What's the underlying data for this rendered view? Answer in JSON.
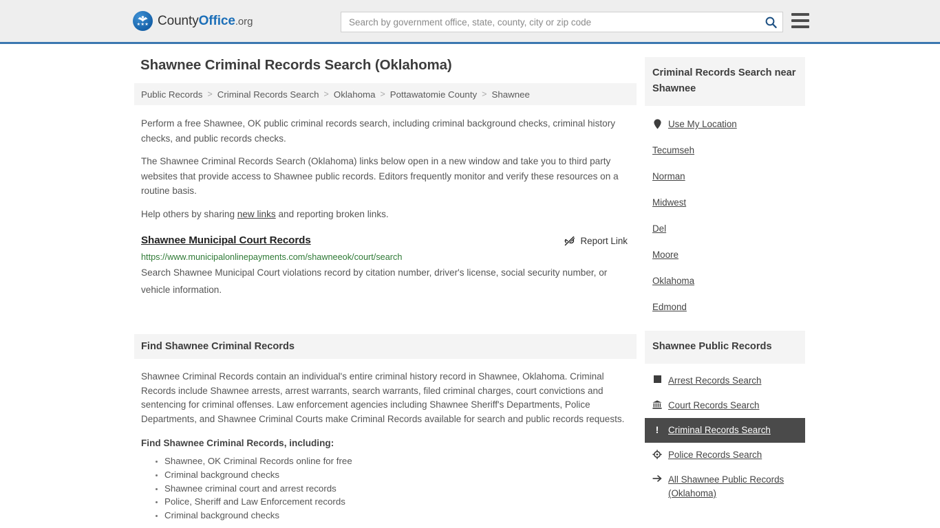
{
  "header": {
    "brand": {
      "county": "County",
      "office": "Office",
      "org": ".org",
      "icon": "eagle-seal-icon",
      "stars": "★★★"
    },
    "search": {
      "placeholder": "Search by government office, state, county, city or zip code",
      "value": "",
      "button_icon": "search-icon"
    },
    "menu_icon": "hamburger-menu-icon",
    "accent_color": "#3b77b0"
  },
  "page": {
    "title": "Shawnee Criminal Records Search (Oklahoma)"
  },
  "breadcrumb": {
    "separator": ">",
    "items": [
      "Public Records",
      "Criminal Records Search",
      "Oklahoma",
      "Pottawatomie County",
      "Shawnee"
    ]
  },
  "intro": {
    "p1": "Perform a free Shawnee, OK public criminal records search, including criminal background checks, criminal history checks, and public records checks.",
    "p2": "The Shawnee Criminal Records Search (Oklahoma) links below open in a new window and take you to third party websites that provide access to Shawnee public records. Editors frequently monitor and verify these resources on a routine basis.",
    "p3_before": "Help others by sharing ",
    "p3_link": "new links",
    "p3_after": " and reporting broken links."
  },
  "result": {
    "title": "Shawnee Municipal Court Records",
    "report_label": "Report Link",
    "report_icon": "broken-link-icon",
    "url": "https://www.municipalonlinepayments.com/shawneeok/court/search",
    "url_color": "#2f7a36",
    "description": "Search Shawnee Municipal Court violations record by citation number, driver's license, social security number, or vehicle information."
  },
  "find_section": {
    "heading": "Find Shawnee Criminal Records",
    "paragraph": "Shawnee Criminal Records contain an individual's entire criminal history record in Shawnee, Oklahoma. Criminal Records include Shawnee arrests, arrest warrants, search warrants, filed criminal charges, court convictions and sentencing for criminal offenses. Law enforcement agencies including Shawnee Sheriff's Departments, Police Departments, and Shawnee Criminal Courts make Criminal Records available for search and public records requests.",
    "subheading": "Find Shawnee Criminal Records, including:",
    "bullets": [
      "Shawnee, OK Criminal Records online for free",
      "Criminal background checks",
      "Shawnee criminal court and arrest records",
      "Police, Sheriff and Law Enforcement records",
      "Criminal background checks"
    ]
  },
  "sidebar": {
    "near": {
      "heading": "Criminal Records Search near Shawnee",
      "items": [
        {
          "label": "Use My Location",
          "icon": "map-pin-icon",
          "has_icon": true
        },
        {
          "label": "Tecumseh",
          "icon": "",
          "has_icon": false
        },
        {
          "label": "Norman",
          "icon": "",
          "has_icon": false
        },
        {
          "label": "Midwest",
          "icon": "",
          "has_icon": false
        },
        {
          "label": "Del",
          "icon": "",
          "has_icon": false
        },
        {
          "label": "Moore",
          "icon": "",
          "has_icon": false
        },
        {
          "label": "Oklahoma",
          "icon": "",
          "has_icon": false
        },
        {
          "label": "Edmond",
          "icon": "",
          "has_icon": false
        }
      ]
    },
    "public_records": {
      "heading": "Shawnee Public Records",
      "active_bg": "#4a4a4a",
      "items": [
        {
          "label": "Arrest Records Search",
          "icon": "filled-square-icon",
          "active": false
        },
        {
          "label": "Court Records Search",
          "icon": "courthouse-icon",
          "active": false
        },
        {
          "label": "Criminal Records Search",
          "icon": "exclamation-icon",
          "active": true
        },
        {
          "label": "Police Records Search",
          "icon": "police-badge-icon",
          "active": false
        },
        {
          "label": "All Shawnee Public Records (Oklahoma)",
          "icon": "arrow-right-icon",
          "active": false
        }
      ]
    }
  }
}
